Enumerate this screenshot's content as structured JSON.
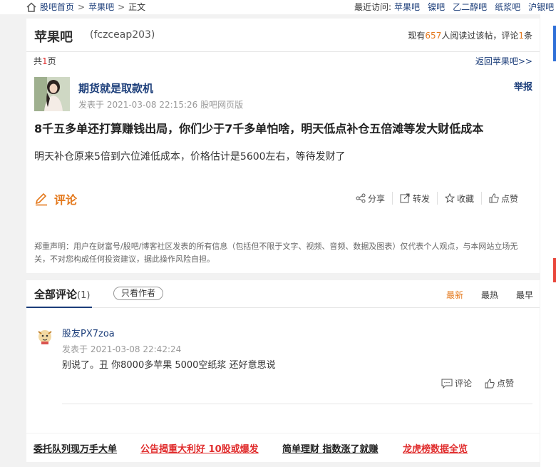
{
  "nav": {
    "home": "股吧首页",
    "sep": ">",
    "bar": "苹果吧",
    "current": "正文",
    "recent_label": "最近访问:",
    "recent": [
      "苹果吧",
      "镍吧",
      "乙二醇吧",
      "纸浆吧",
      "沪银吧"
    ]
  },
  "header": {
    "title": "苹果吧",
    "code": "(fczceap203)",
    "stats_pre": "现有",
    "reads": "657",
    "stats_mid": "人阅读过该帖，评论",
    "comments": "1",
    "stats_post": "条",
    "pages_pre": "共",
    "pages": "1",
    "pages_post": "页",
    "back": "返回苹果吧>>"
  },
  "post": {
    "author": "期货就是取款机",
    "meta": "发表于 2021-03-08 22:15:26 股吧网页版",
    "report": "举报",
    "title": "8千五多单还打算赚钱出局，你们少于7千多单怕啥，明天低点补仓五倍滩等发大财低成本",
    "body": "明天补仓原来5倍到六位滩低成本，价格估计是5600左右，等待发财了",
    "comment_btn": "评论",
    "actions": {
      "share": "分享",
      "forward": "转发",
      "collect": "收藏",
      "like": "点赞"
    },
    "disclaimer": "郑重声明：用户在财富号/股吧/博客社区发表的所有信息（包括但不限于文字、视频、音频、数据及图表）仅代表个人观点，与本网站立场无关，不对您构成任何投资建议，据此操作风险自担。"
  },
  "comments": {
    "tab_label": "全部评论",
    "count": "(1)",
    "only_author": "只看作者",
    "sort": [
      "最新",
      "最热",
      "最早"
    ],
    "items": [
      {
        "user": "股友PX7zoa",
        "meta": "发表于 2021-03-08 22:42:24",
        "text": "别说了。丑 你8000多苹果 5000空纸浆 还好意思说",
        "reply": "评论",
        "like": "点赞"
      }
    ]
  },
  "ads": [
    "委托队列现万手大单",
    "公告揭重大利好 10股或爆发",
    "简单理财 指数涨了就赚",
    "龙虎榜数据全览"
  ],
  "colors": {
    "link": "#1c3e7a",
    "orange": "#e4791d",
    "red": "#e02d2d",
    "bg": "#f2f2f2"
  }
}
